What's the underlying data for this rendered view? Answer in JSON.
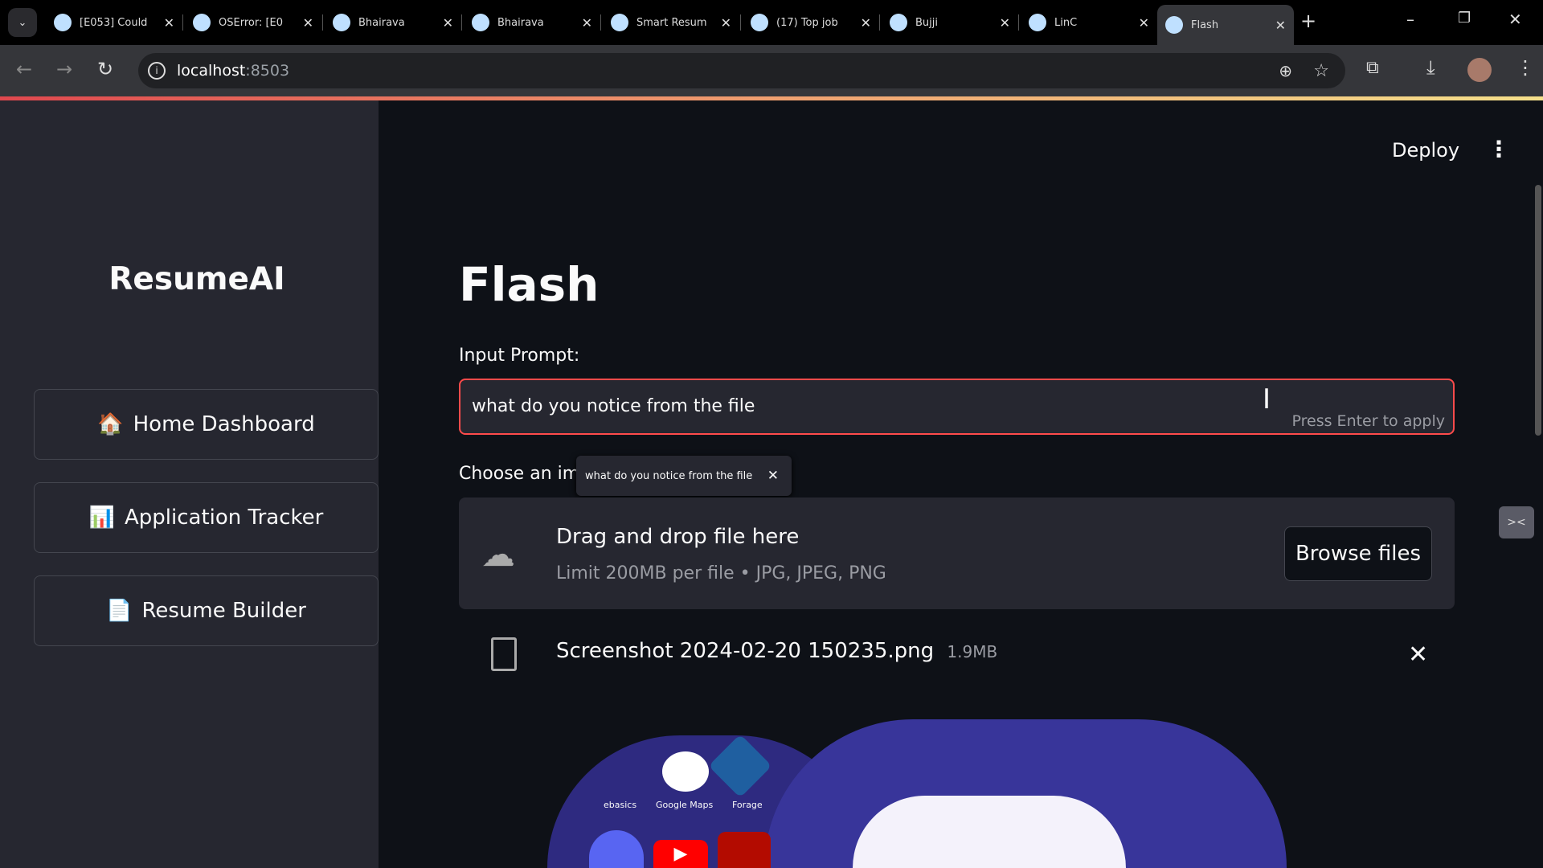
{
  "browser": {
    "tabs": [
      {
        "title": "[E053] Could",
        "icon": "github-icon"
      },
      {
        "title": "OSError: [E0",
        "icon": "github-icon"
      },
      {
        "title": "Bhairava",
        "icon": "chat-icon"
      },
      {
        "title": "Bhairava",
        "icon": "chat-icon"
      },
      {
        "title": "Smart Resum",
        "icon": "linc-icon"
      },
      {
        "title": "(17) Top job",
        "icon": "linkedin-icon"
      },
      {
        "title": "Bujji",
        "icon": "chat-icon"
      },
      {
        "title": "LinC",
        "icon": "globe-icon"
      },
      {
        "title": "Flash",
        "icon": "chat-icon"
      }
    ],
    "url_host": "localhost",
    "url_port": ":8503"
  },
  "sidebar": {
    "title": "ResumeAI",
    "items": [
      {
        "emoji": "🏠",
        "label": "Home Dashboard"
      },
      {
        "emoji": "📊",
        "label": "Application Tracker"
      },
      {
        "emoji": "📄",
        "label": "Resume Builder"
      }
    ]
  },
  "header": {
    "deploy": "Deploy"
  },
  "main": {
    "title": "Flash",
    "prompt_label": "Input Prompt:",
    "prompt_value": "what do you notice from the file",
    "prompt_hint": "Press Enter to apply",
    "tooltip": "what do you notice from the file",
    "upload_label": "Choose an im",
    "drop_title": "Drag and drop file here",
    "drop_limit": "Limit 200MB per file • JPG, JPEG, PNG",
    "browse": "Browse files",
    "file_name": "Screenshot 2024-02-20 150235.png",
    "file_size": "1.9MB"
  },
  "preview": {
    "labels": [
      "ebasics",
      "Google Maps",
      "Forage"
    ]
  }
}
